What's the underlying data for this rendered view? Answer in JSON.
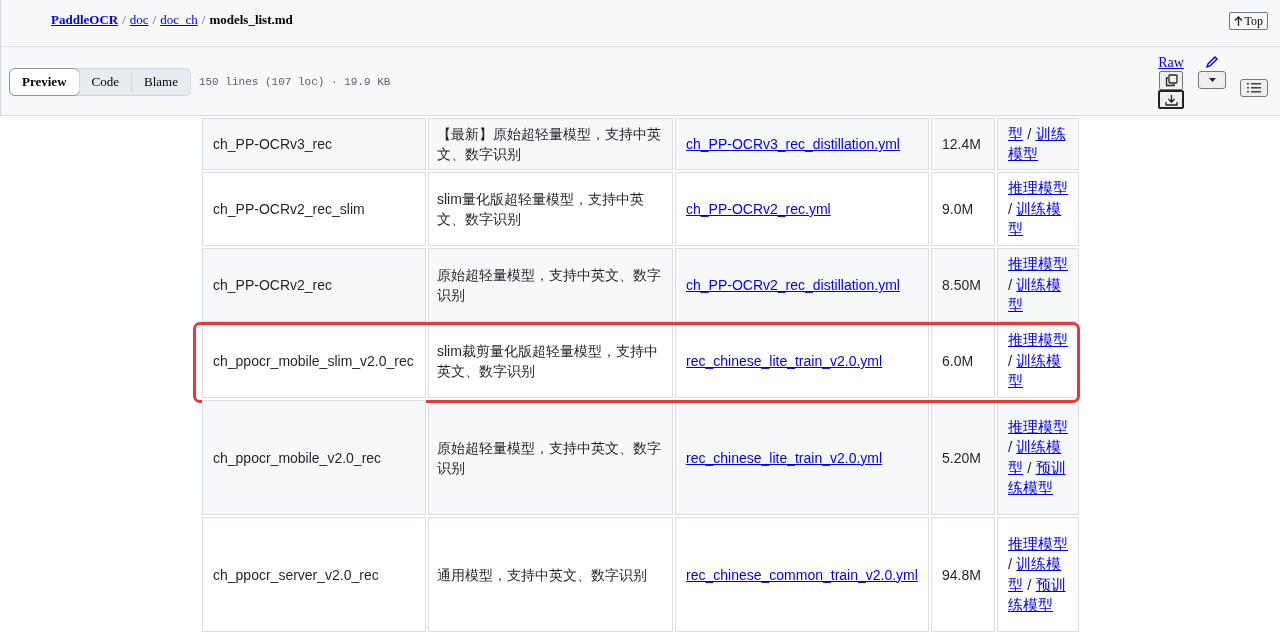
{
  "breadcrumb": {
    "links": [
      "PaddleOCR",
      "doc",
      "doc_ch"
    ],
    "separator": "/",
    "current": "models_list.md"
  },
  "top_button": "Top",
  "view_tabs": [
    {
      "label": "Preview",
      "selected": true
    },
    {
      "label": "Code",
      "selected": false
    },
    {
      "label": "Blame",
      "selected": false
    }
  ],
  "file_info": "150 lines (107 loc) · 19.9 KB",
  "raw_link": "Raw",
  "table": {
    "link_separator": "/",
    "rows": [
      {
        "model": "ch_PP-OCRv3_rec",
        "description": "【最新】原始超轻量模型，支持中英文、数字识别",
        "config": "ch_PP-OCRv3_rec_distillation.yml",
        "size": "12.4M",
        "links": [
          "型",
          "训练模型"
        ],
        "highlighted": false
      },
      {
        "model": "ch_PP-OCRv2_rec_slim",
        "description": "slim量化版超轻量模型，支持中英文、数字识别",
        "config": "ch_PP-OCRv2_rec.yml",
        "size": "9.0M",
        "links": [
          "推理模型",
          "训练模型"
        ],
        "highlighted": false
      },
      {
        "model": "ch_PP-OCRv2_rec",
        "description": "原始超轻量模型，支持中英文、数字识别",
        "config": "ch_PP-OCRv2_rec_distillation.yml",
        "size": "8.50M",
        "links": [
          "推理模型",
          "训练模型"
        ],
        "highlighted": false
      },
      {
        "model": "ch_ppocr_mobile_slim_v2.0_rec",
        "description": "slim裁剪量化版超轻量模型，支持中英文、数字识别",
        "config": "rec_chinese_lite_train_v2.0.yml",
        "size": "6.0M",
        "links": [
          "推理模型",
          "训练模型"
        ],
        "highlighted": true
      },
      {
        "model": "ch_ppocr_mobile_v2.0_rec",
        "description": "原始超轻量模型，支持中英文、数字识别",
        "config": "rec_chinese_lite_train_v2.0.yml",
        "size": "5.20M",
        "links": [
          "推理模型",
          "训练模型",
          "预训练模型"
        ],
        "highlighted": false
      },
      {
        "model": "ch_ppocr_server_v2.0_rec",
        "description": "通用模型，支持中英文、数字识别",
        "config": "rec_chinese_common_train_v2.0.yml",
        "size": "94.8M",
        "links": [
          "推理模型",
          "训练模型",
          "预训练模型"
        ],
        "highlighted": false
      }
    ]
  }
}
